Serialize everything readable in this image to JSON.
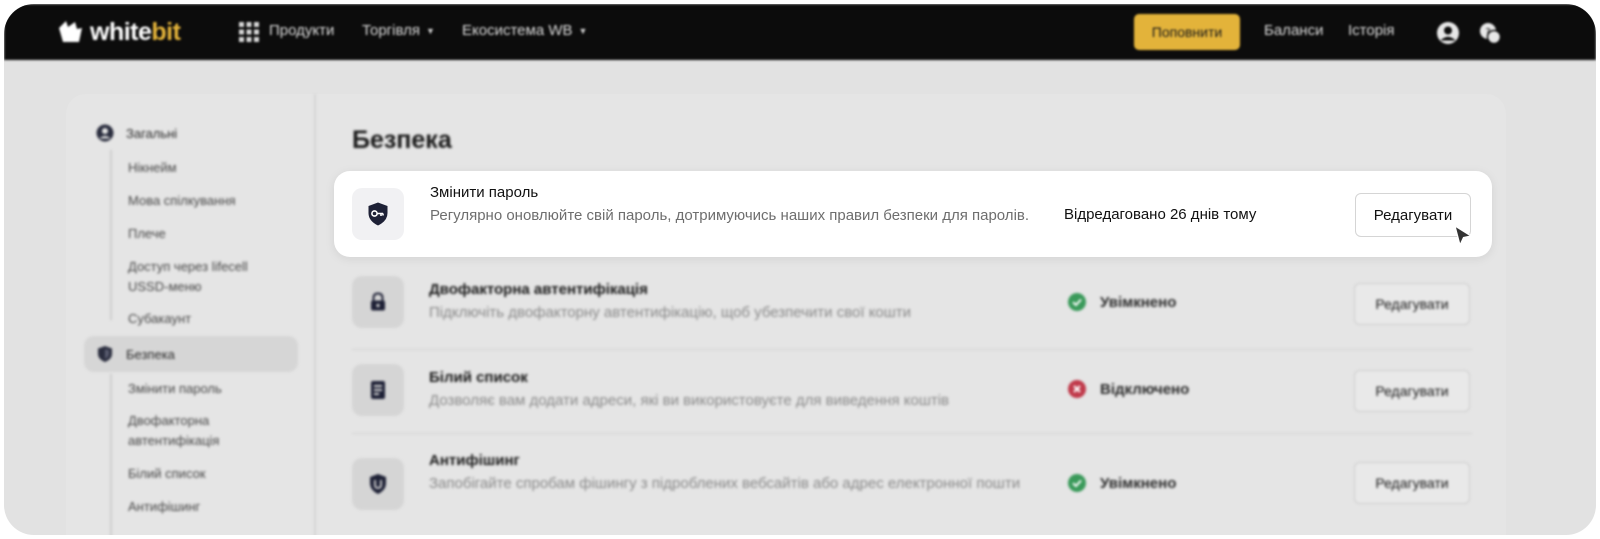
{
  "header": {
    "logo": {
      "text_white": "white",
      "text_gold": "bit"
    },
    "nav": [
      {
        "label": "Продукти",
        "icon": "grid-icon",
        "has_caret": false
      },
      {
        "label": "Торгівля",
        "has_caret": true
      },
      {
        "label": "Екосистема WB",
        "has_caret": true
      }
    ],
    "deposit_label": "Поповнити",
    "balances_label": "Баланси",
    "history_label": "Історія",
    "icons": [
      "user-icon",
      "support-icon"
    ]
  },
  "sidebar": {
    "general": {
      "label": "Загальні",
      "icon": "user-icon",
      "items": [
        "Нікнейм",
        "Мова спілкування",
        "Плече",
        "Доступ через lifecell USSD-меню",
        "Субакаунт"
      ]
    },
    "security": {
      "label": "Безпека",
      "icon": "shield-icon",
      "items": [
        "Змінити пароль",
        "Двофакторна автентифікація",
        "Білий список",
        "Антифішинг"
      ]
    }
  },
  "page": {
    "title": "Безпека",
    "edit_label": "Редагувати",
    "highlighted": {
      "title": "Змінити пароль",
      "description": "Регулярно оновлюйте свій пароль, дотримуючись наших правил безпеки для паролів.",
      "edited": "Відредаговано 26 днів тому",
      "icon": "key-shield-icon"
    },
    "rows": [
      {
        "title": "Двофакторна автентифікація",
        "description": "Підключіть двофакторну автентифікацію, щоб убезпечити свої кошти",
        "status": "Увімкнено",
        "status_kind": "on",
        "icon": "lock-icon"
      },
      {
        "title": "Білий список",
        "description": "Дозволяє вам додати адреси, які ви використовуєте для виведення коштів",
        "status": "Відключено",
        "status_kind": "off",
        "icon": "whitelist-icon"
      },
      {
        "title": "Антифішинг",
        "description": "Запобігайте спробам фішингу з підроблених вебсайтів або адрес електронної пошти",
        "status": "Увімкнено",
        "status_kind": "on",
        "icon": "antiphishing-icon"
      }
    ]
  },
  "colors": {
    "gold": "#e3b33a",
    "status_on": "#3a9a5a",
    "status_off": "#c0394a",
    "icon_navy": "#1e2136"
  }
}
